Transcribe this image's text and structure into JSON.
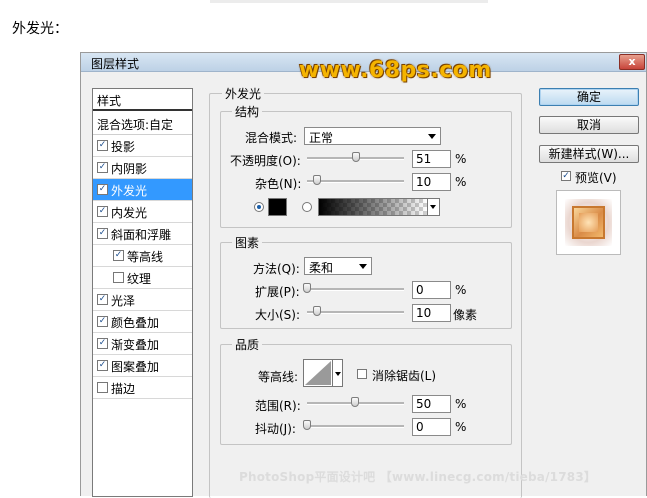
{
  "page_heading": "外发光：",
  "dialog": {
    "title": "图层样式",
    "close_symbol": "x",
    "watermark_top": "www.68ps.com",
    "watermark_bottom": "PhotoShop平面设计吧 【www.linecg.com/tieba/1783】"
  },
  "styles_panel": {
    "header": "样式",
    "blend_options": "混合选项:自定",
    "items": [
      {
        "label": "投影",
        "checked": true
      },
      {
        "label": "内阴影",
        "checked": true
      },
      {
        "label": "外发光",
        "checked": true,
        "selected": true
      },
      {
        "label": "内发光",
        "checked": true
      },
      {
        "label": "斜面和浮雕",
        "checked": true
      },
      {
        "label": "等高线",
        "checked": true,
        "indent": true
      },
      {
        "label": "纹理",
        "checked": false,
        "indent": true
      },
      {
        "label": "光泽",
        "checked": true
      },
      {
        "label": "颜色叠加",
        "checked": true
      },
      {
        "label": "渐变叠加",
        "checked": true
      },
      {
        "label": "图案叠加",
        "checked": true
      },
      {
        "label": "描边",
        "checked": false
      }
    ]
  },
  "outer_glow": {
    "title": "外发光",
    "structure": {
      "title": "结构",
      "blend_mode_label": "混合模式:",
      "blend_mode_value": "正常",
      "opacity_label": "不透明度(O):",
      "opacity_value": "51",
      "opacity_unit": "%",
      "noise_label": "杂色(N):",
      "noise_value": "10",
      "noise_unit": "%",
      "glow_color": "#000000"
    },
    "elements": {
      "title": "图素",
      "technique_label": "方法(Q):",
      "technique_value": "柔和",
      "spread_label": "扩展(P):",
      "spread_value": "0",
      "spread_unit": "%",
      "size_label": "大小(S):",
      "size_value": "10",
      "size_unit": "像素"
    },
    "quality": {
      "title": "品质",
      "contour_label": "等高线:",
      "antialias_label": "消除锯齿(L)",
      "antialias_checked": false,
      "range_label": "范围(R):",
      "range_value": "50",
      "range_unit": "%",
      "jitter_label": "抖动(J):",
      "jitter_value": "0",
      "jitter_unit": "%"
    }
  },
  "right_panel": {
    "ok_label": "确定",
    "cancel_label": "取消",
    "new_style_label": "新建样式(W)...",
    "preview_label": "预览(V)",
    "preview_checked": true
  }
}
